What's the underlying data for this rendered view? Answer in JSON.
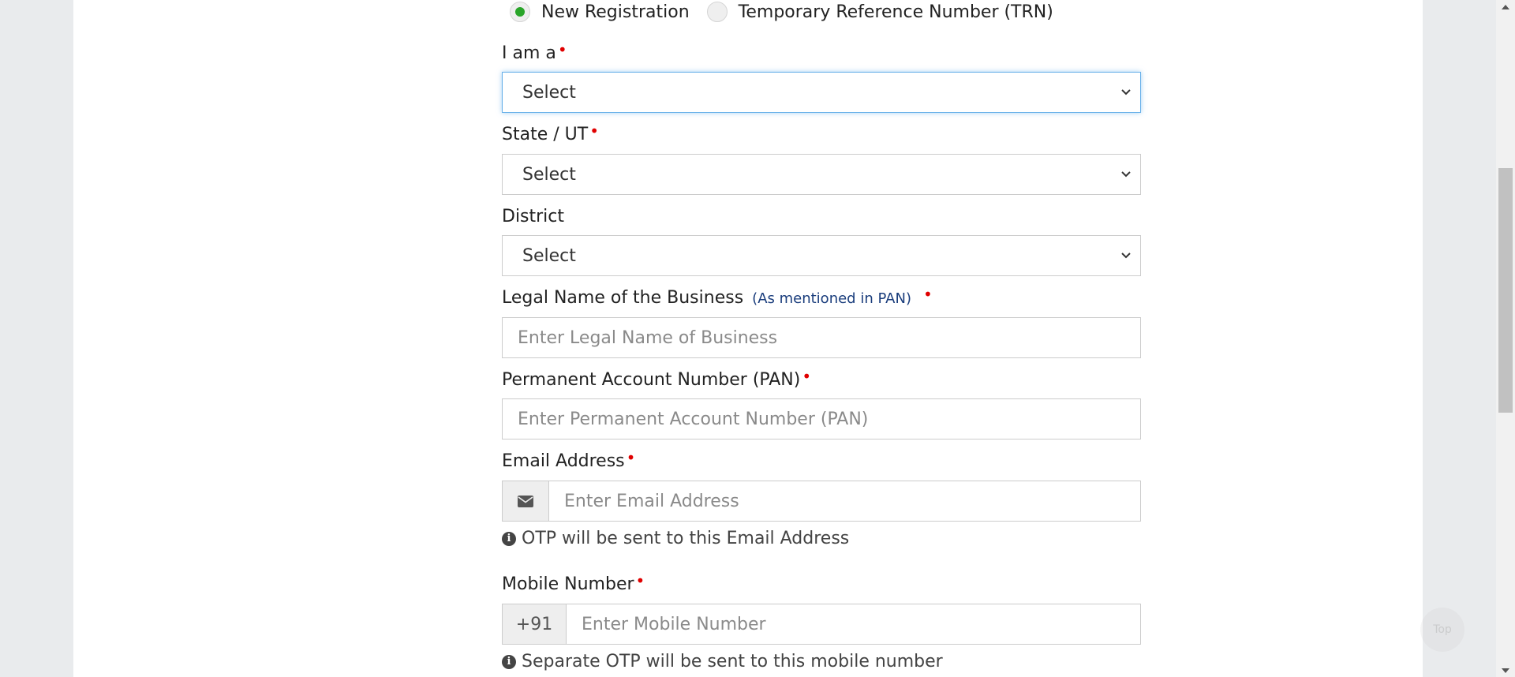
{
  "radios": [
    {
      "label": "New Registration",
      "checked": true
    },
    {
      "label": "Temporary Reference Number (TRN)",
      "checked": false
    }
  ],
  "fields": {
    "i_am_a": {
      "label": "I am a",
      "required_marker": "•",
      "value": "Select"
    },
    "state_ut": {
      "label": "State / UT",
      "required_marker": "•",
      "value": "Select"
    },
    "district": {
      "label": "District",
      "value": "Select"
    },
    "legal_name": {
      "label": "Legal Name of the Business",
      "hint": "(As mentioned in PAN)",
      "required_marker": "•",
      "placeholder": "Enter Legal Name of Business"
    },
    "pan": {
      "label": "Permanent Account Number (PAN)",
      "required_marker": "•",
      "placeholder": "Enter Permanent Account Number (PAN)"
    },
    "email": {
      "label": "Email Address",
      "required_marker": "•",
      "placeholder": "Enter Email Address",
      "icon": "envelope-icon",
      "help": "OTP will be sent to this Email Address"
    },
    "mobile": {
      "label": "Mobile Number",
      "required_marker": "•",
      "prefix": "+91",
      "placeholder": "Enter Mobile Number",
      "help": "Separate OTP will be sent to this mobile number"
    }
  },
  "top_button": {
    "label": "Top"
  },
  "colors": {
    "accent_green": "#2aa52a",
    "required_red": "#e00000",
    "hint_blue": "#1a3d7c",
    "focus_blue": "#66afe9"
  }
}
